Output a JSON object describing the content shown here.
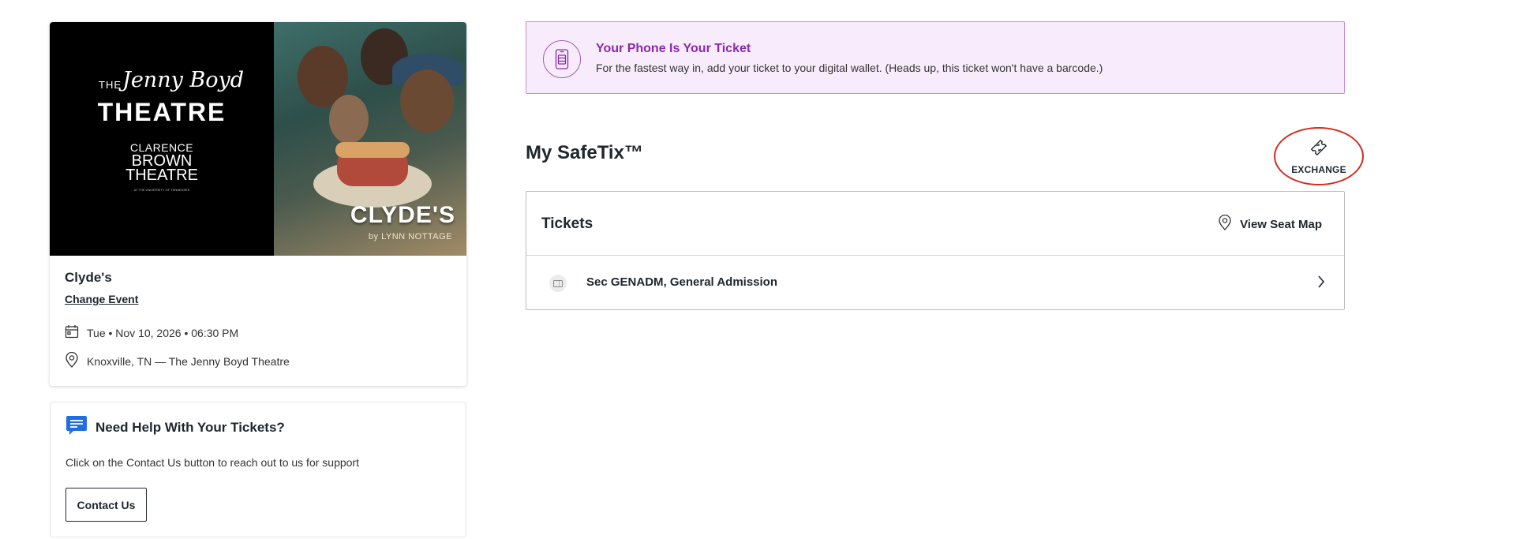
{
  "event": {
    "name": "Clyde's",
    "change_event_label": "Change Event",
    "date": "Tue • Nov 10, 2026 • 06:30 PM",
    "venue": "Knoxville, TN — The Jenny Boyd Theatre",
    "image": {
      "logo_the": "THE",
      "logo_script": "Jenny Boyd",
      "logo_theatre": "THEATRE",
      "logo_line1": "CLARENCE",
      "logo_line2": "BROWN",
      "logo_line3": "THEATRE",
      "logo_tiny": "AT THE UNIVERSITY OF TENNESSEE",
      "play_title": "CLYDE'S",
      "play_subtitle": "by LYNN NOTTAGE"
    }
  },
  "help": {
    "title": "Need Help With Your Tickets?",
    "text": "Click on the Contact Us button to reach out to us for support",
    "button_label": "Contact Us"
  },
  "phone_banner": {
    "title": "Your Phone Is Your Ticket",
    "text": "For the fastest way in, add your ticket to your digital wallet. (Heads up, this ticket won't have a barcode.)"
  },
  "safetix": {
    "title": "My SafeTix™",
    "exchange_label": "EXCHANGE",
    "tickets_label": "Tickets",
    "view_seat_map_label": "View Seat Map",
    "ticket_rows": [
      {
        "label": "Sec GENADM, General Admission"
      }
    ]
  },
  "colors": {
    "accent_purple": "#8a2aa9",
    "banner_bg": "#f8ecfc",
    "help_icon_blue": "#1f6fe0",
    "annotation_red": "#d32a1e",
    "text_dark": "#1f262d"
  },
  "icons": {
    "date": "calendar-icon",
    "venue": "location-pin-icon",
    "help": "chat-icon",
    "phone": "phone-ticket-icon",
    "exchange": "exchange-ticket-icon",
    "seat_map": "location-pin-icon",
    "ticket": "ticket-icon",
    "row_arrow": "chevron-right-icon"
  }
}
